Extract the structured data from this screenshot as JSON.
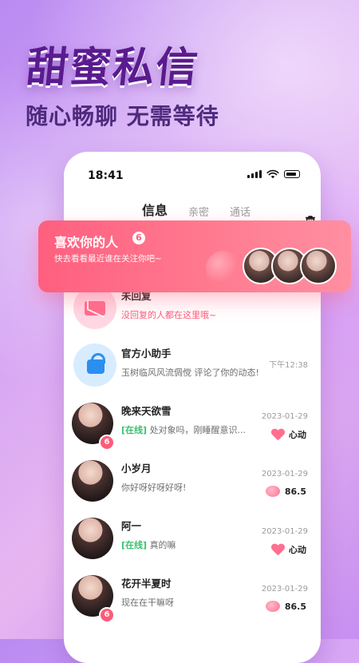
{
  "hero": {
    "title": "甜蜜私信",
    "subtitle": "随心畅聊 无需等待"
  },
  "status_bar": {
    "time": "18:41"
  },
  "tabs": [
    {
      "label": "信息",
      "active": true
    },
    {
      "label": "亲密",
      "active": false
    },
    {
      "label": "通话",
      "active": false
    }
  ],
  "promo": {
    "title": "喜欢你的人",
    "count": "6",
    "subtitle": "快去看看最近谁在关注你吧~"
  },
  "list": {
    "unreplied": {
      "title": "未回复",
      "message": "没回复的人都在这里哦~"
    },
    "assistant": {
      "title": "官方小助手",
      "message": "玉树临风风流倜傥 评论了你的动态!",
      "time": "下午12:38"
    },
    "users": [
      {
        "name": "晚来天欲雪",
        "badge": "6",
        "status": "[在线]",
        "message": "处对象吗，刚睡醒意识...",
        "date": "2023-01-29",
        "meta": "心动"
      },
      {
        "name": "小岁月",
        "badge": "",
        "status": "",
        "message": "你好呀好呀好呀!",
        "date": "2023-01-29",
        "meta": "86.5"
      },
      {
        "name": "阿一",
        "badge": "",
        "status": "[在线]",
        "message": "真的嘛",
        "date": "2023-01-29",
        "meta": "心动"
      },
      {
        "name": "花开半夏时",
        "badge": "6",
        "status": "",
        "message": "现在在干嘛呀",
        "date": "2023-01-29",
        "meta": "86.5"
      }
    ]
  },
  "colors": {
    "accent": "#ff5a7a",
    "online": "#3bbf6f",
    "hero_title": "#5a1b8f"
  }
}
